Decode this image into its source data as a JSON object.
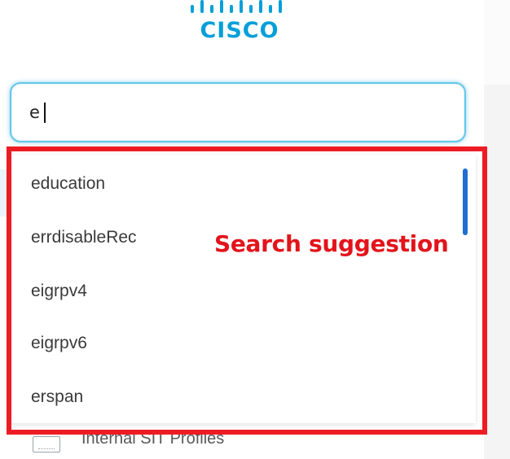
{
  "brand": {
    "logo_text": "CISCO",
    "color": "#049fd9"
  },
  "search": {
    "value": "e",
    "focus_color": "#66c6ea"
  },
  "suggestions": [
    "education",
    "errdisableRec",
    "eigrpv4",
    "eigrpv6",
    "erspan"
  ],
  "background_menu_item": {
    "label": "Internal SIT Profiles",
    "icon": "profile-card-icon"
  },
  "annotation": {
    "label": "Search suggestion",
    "color": "#ed1c24"
  }
}
